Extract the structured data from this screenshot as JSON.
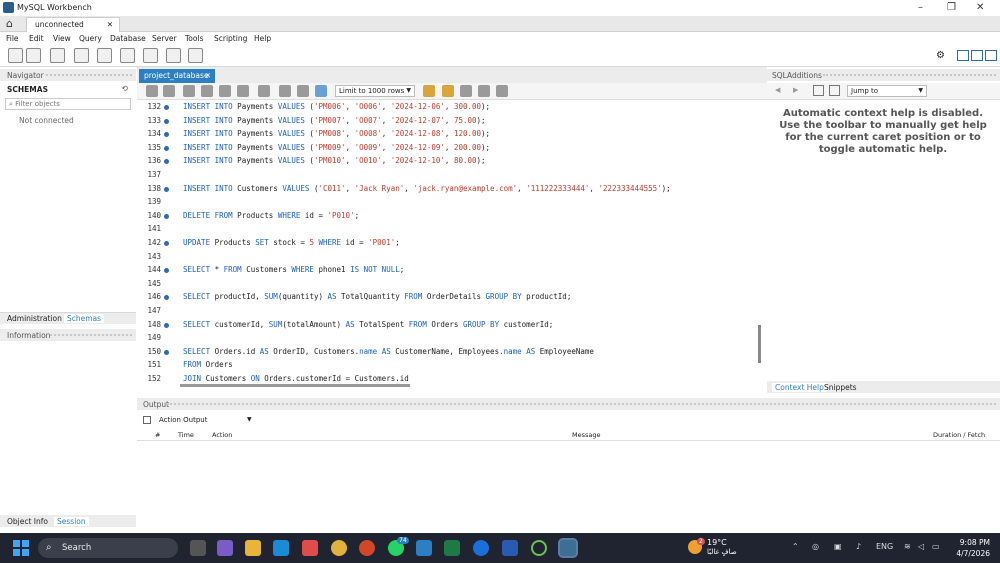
{
  "window": {
    "title": "MySQL Workbench",
    "controls": {
      "minimize": "–",
      "maximize": "❐",
      "close": "✕"
    }
  },
  "connection_tab": {
    "label": "unconnected",
    "close": "✕"
  },
  "menu": [
    "File",
    "Edit",
    "View",
    "Query",
    "Database",
    "Server",
    "Tools",
    "Scripting",
    "Help"
  ],
  "navigator": {
    "title": "Navigator",
    "schemas_label": "SCHEMAS",
    "filter_placeholder": "Filter objects",
    "status": "Not connected",
    "tabs": [
      "Administration",
      "Schemas"
    ],
    "info_title": "Information",
    "bottom_tabs": [
      "Object Info",
      "Session"
    ]
  },
  "editor": {
    "tab_label": "project_database",
    "tab_close": "✕",
    "limit_label": "Limit to 1000 rows",
    "lines": [
      {
        "n": "132",
        "b": true,
        "parts": [
          [
            "kw",
            "INSERT INTO"
          ],
          [
            "t",
            " Payments "
          ],
          [
            "kw",
            "VALUES"
          ],
          [
            "t",
            " ("
          ],
          [
            "str",
            "'PM006'"
          ],
          [
            "t",
            ", "
          ],
          [
            "str",
            "'O006'"
          ],
          [
            "t",
            ", "
          ],
          [
            "str",
            "'2024-12-06'"
          ],
          [
            "t",
            ", "
          ],
          [
            "str",
            "300.00"
          ],
          [
            "t",
            ");"
          ]
        ]
      },
      {
        "n": "133",
        "b": true,
        "parts": [
          [
            "kw",
            "INSERT INTO"
          ],
          [
            "t",
            " Payments "
          ],
          [
            "kw",
            "VALUES"
          ],
          [
            "t",
            " ("
          ],
          [
            "str",
            "'PM007'"
          ],
          [
            "t",
            ", "
          ],
          [
            "str",
            "'O007'"
          ],
          [
            "t",
            ", "
          ],
          [
            "str",
            "'2024-12-07'"
          ],
          [
            "t",
            ", "
          ],
          [
            "str",
            "75.00"
          ],
          [
            "t",
            ");"
          ]
        ]
      },
      {
        "n": "134",
        "b": true,
        "parts": [
          [
            "kw",
            "INSERT INTO"
          ],
          [
            "t",
            " Payments "
          ],
          [
            "kw",
            "VALUES"
          ],
          [
            "t",
            " ("
          ],
          [
            "str",
            "'PM008'"
          ],
          [
            "t",
            ", "
          ],
          [
            "str",
            "'O008'"
          ],
          [
            "t",
            ", "
          ],
          [
            "str",
            "'2024-12-08'"
          ],
          [
            "t",
            ", "
          ],
          [
            "str",
            "120.00"
          ],
          [
            "t",
            ");"
          ]
        ]
      },
      {
        "n": "135",
        "b": true,
        "parts": [
          [
            "kw",
            "INSERT INTO"
          ],
          [
            "t",
            " Payments "
          ],
          [
            "kw",
            "VALUES"
          ],
          [
            "t",
            " ("
          ],
          [
            "str",
            "'PM009'"
          ],
          [
            "t",
            ", "
          ],
          [
            "str",
            "'O009'"
          ],
          [
            "t",
            ", "
          ],
          [
            "str",
            "'2024-12-09'"
          ],
          [
            "t",
            ", "
          ],
          [
            "str",
            "200.00"
          ],
          [
            "t",
            ");"
          ]
        ]
      },
      {
        "n": "136",
        "b": true,
        "parts": [
          [
            "kw",
            "INSERT INTO"
          ],
          [
            "t",
            " Payments "
          ],
          [
            "kw",
            "VALUES"
          ],
          [
            "t",
            " ("
          ],
          [
            "str",
            "'PM010'"
          ],
          [
            "t",
            ", "
          ],
          [
            "str",
            "'O010'"
          ],
          [
            "t",
            ", "
          ],
          [
            "str",
            "'2024-12-10'"
          ],
          [
            "t",
            ", "
          ],
          [
            "str",
            "80.00"
          ],
          [
            "t",
            ");"
          ]
        ]
      },
      {
        "n": "137",
        "b": false,
        "parts": []
      },
      {
        "n": "138",
        "b": true,
        "parts": [
          [
            "kw",
            "INSERT INTO"
          ],
          [
            "t",
            " Customers "
          ],
          [
            "kw",
            "VALUES"
          ],
          [
            "t",
            " ("
          ],
          [
            "str",
            "'C011'"
          ],
          [
            "t",
            ", "
          ],
          [
            "str",
            "'Jack Ryan'"
          ],
          [
            "t",
            ", "
          ],
          [
            "str",
            "'jack.ryan@example.com'"
          ],
          [
            "t",
            ", "
          ],
          [
            "str",
            "'111222333444'"
          ],
          [
            "t",
            ", "
          ],
          [
            "str",
            "'222333444555'"
          ],
          [
            "t",
            ");"
          ]
        ]
      },
      {
        "n": "139",
        "b": false,
        "parts": []
      },
      {
        "n": "140",
        "b": true,
        "parts": [
          [
            "kw",
            "DELETE FROM"
          ],
          [
            "t",
            " Products "
          ],
          [
            "kw",
            "WHERE"
          ],
          [
            "t",
            " id = "
          ],
          [
            "str",
            "'P010'"
          ],
          [
            "t",
            ";"
          ]
        ]
      },
      {
        "n": "141",
        "b": false,
        "parts": []
      },
      {
        "n": "142",
        "b": true,
        "parts": [
          [
            "kw",
            "UPDATE"
          ],
          [
            "t",
            " Products "
          ],
          [
            "kw",
            "SET"
          ],
          [
            "t",
            " stock = "
          ],
          [
            "str",
            "5"
          ],
          [
            "t",
            " "
          ],
          [
            "kw",
            "WHERE"
          ],
          [
            "t",
            " id = "
          ],
          [
            "str",
            "'P001'"
          ],
          [
            "t",
            ";"
          ]
        ]
      },
      {
        "n": "143",
        "b": false,
        "parts": []
      },
      {
        "n": "144",
        "b": true,
        "parts": [
          [
            "kw",
            "SELECT"
          ],
          [
            "t",
            " * "
          ],
          [
            "kw",
            "FROM"
          ],
          [
            "t",
            " Customers "
          ],
          [
            "kw",
            "WHERE"
          ],
          [
            "t",
            " phone1 "
          ],
          [
            "kw",
            "IS NOT NULL"
          ],
          [
            "t",
            ";"
          ]
        ]
      },
      {
        "n": "145",
        "b": false,
        "parts": []
      },
      {
        "n": "146",
        "b": true,
        "parts": [
          [
            "kw",
            "SELECT"
          ],
          [
            "t",
            " productId, "
          ],
          [
            "kw",
            "SUM"
          ],
          [
            "t",
            "(quantity) "
          ],
          [
            "kw",
            "AS"
          ],
          [
            "t",
            " TotalQuantity "
          ],
          [
            "kw",
            "FROM"
          ],
          [
            "t",
            " OrderDetails "
          ],
          [
            "kw",
            "GROUP BY"
          ],
          [
            "t",
            " productId;"
          ]
        ]
      },
      {
        "n": "147",
        "b": false,
        "parts": []
      },
      {
        "n": "148",
        "b": true,
        "parts": [
          [
            "kw",
            "SELECT"
          ],
          [
            "t",
            " customerId, "
          ],
          [
            "kw",
            "SUM"
          ],
          [
            "t",
            "(totalAmount) "
          ],
          [
            "kw",
            "AS"
          ],
          [
            "t",
            " TotalSpent "
          ],
          [
            "kw",
            "FROM"
          ],
          [
            "t",
            " Orders "
          ],
          [
            "kw",
            "GROUP BY"
          ],
          [
            "t",
            " customerId;"
          ]
        ]
      },
      {
        "n": "149",
        "b": false,
        "parts": []
      },
      {
        "n": "150",
        "b": true,
        "parts": [
          [
            "kw",
            "SELECT"
          ],
          [
            "t",
            " Orders.id "
          ],
          [
            "kw",
            "AS"
          ],
          [
            "t",
            " OrderID, Customers."
          ],
          [
            "kw",
            "name"
          ],
          [
            "t",
            " "
          ],
          [
            "kw",
            "AS"
          ],
          [
            "t",
            " CustomerName, Employees."
          ],
          [
            "kw",
            "name"
          ],
          [
            "t",
            " "
          ],
          [
            "kw",
            "AS"
          ],
          [
            "t",
            " EmployeeName"
          ]
        ]
      },
      {
        "n": "151",
        "b": false,
        "parts": [
          [
            "kw",
            "FROM"
          ],
          [
            "t",
            " Orders"
          ]
        ]
      },
      {
        "n": "152",
        "b": false,
        "parts": [
          [
            "kw",
            "JOIN"
          ],
          [
            "t",
            " Customers "
          ],
          [
            "kw",
            "ON"
          ],
          [
            "t",
            " Orders.customerId = Customers.id"
          ]
        ]
      }
    ]
  },
  "output": {
    "title": "Output",
    "selector": "Action Output",
    "columns": [
      "#",
      "Time",
      "Action",
      "Message",
      "Duration / Fetch"
    ]
  },
  "sql_additions": {
    "title": "SQLAdditions",
    "jump_to": "Jump to",
    "help_text": "Automatic context help is disabled. Use the toolbar to manually get help for the current caret position or to toggle automatic help.",
    "tabs": [
      "Context Help",
      "Snippets"
    ]
  },
  "taskbar": {
    "search_label": "Search",
    "weather_temp": "19°C",
    "weather_desc": "صافٍ غالبًا",
    "weather_badge": "2",
    "whatsapp_badge": "74",
    "lang": "ENG",
    "time": "9:08 PM",
    "date": "4/7/2026"
  },
  "colors": {
    "accent": "#2b7fc2",
    "keyword": "#1a5fbf",
    "string": "#c0392b",
    "taskbar": "#1f2430"
  }
}
